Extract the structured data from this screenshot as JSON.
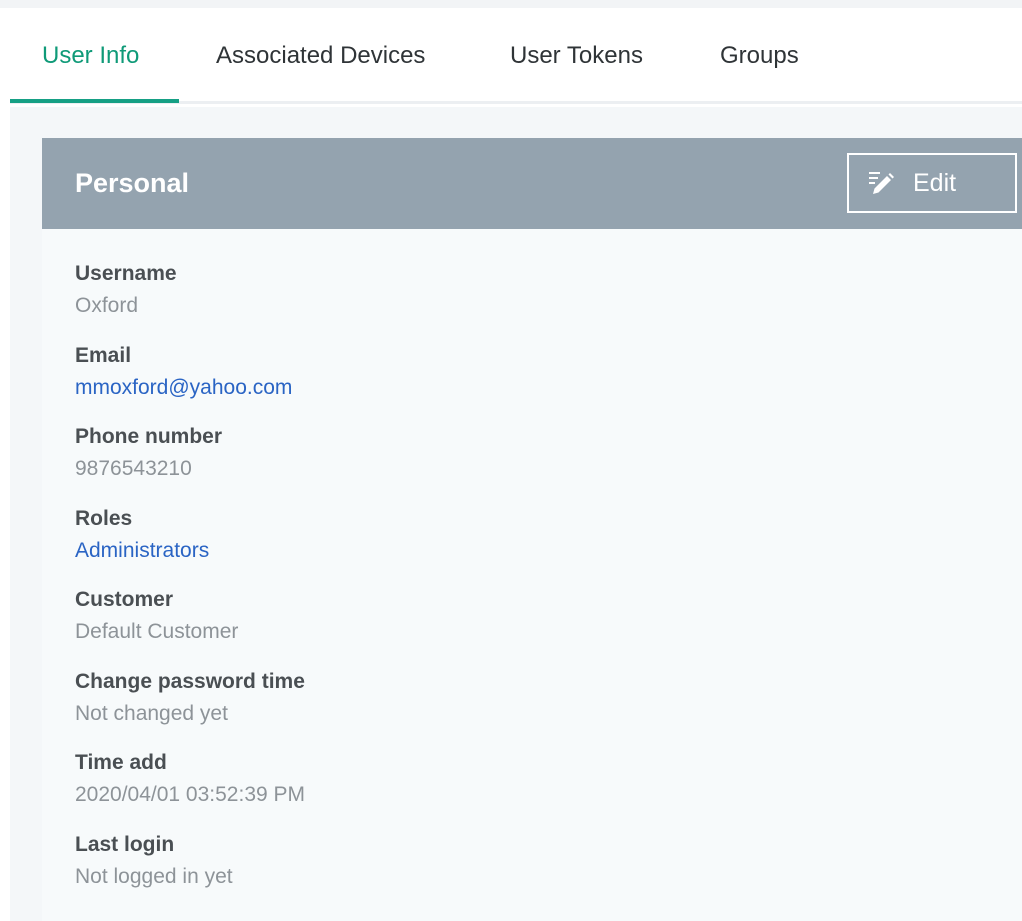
{
  "tabs": [
    {
      "label": "User Info",
      "active": true
    },
    {
      "label": "Associated Devices",
      "active": false
    },
    {
      "label": "User Tokens",
      "active": false
    },
    {
      "label": "Groups",
      "active": false
    }
  ],
  "panel": {
    "title": "Personal",
    "edit_label": "Edit",
    "edit_icon": "edit-pencil-icon",
    "header_color": "#94a3af"
  },
  "fields": [
    {
      "label": "Username",
      "value": "Oxford",
      "link": false
    },
    {
      "label": "Email",
      "value": "mmoxford@yahoo.com",
      "link": true
    },
    {
      "label": "Phone number",
      "value": "9876543210",
      "link": false
    },
    {
      "label": "Roles",
      "value": "Administrators",
      "link": true
    },
    {
      "label": "Customer",
      "value": "Default Customer",
      "link": false
    },
    {
      "label": "Change password time",
      "value": "Not changed yet",
      "link": false
    },
    {
      "label": "Time add",
      "value": "2020/04/01 03:52:39 PM",
      "link": false
    },
    {
      "label": "Last login",
      "value": "Not logged in yet",
      "link": false
    }
  ],
  "colors": {
    "accent": "#16a085",
    "link": "#2a64c4"
  }
}
